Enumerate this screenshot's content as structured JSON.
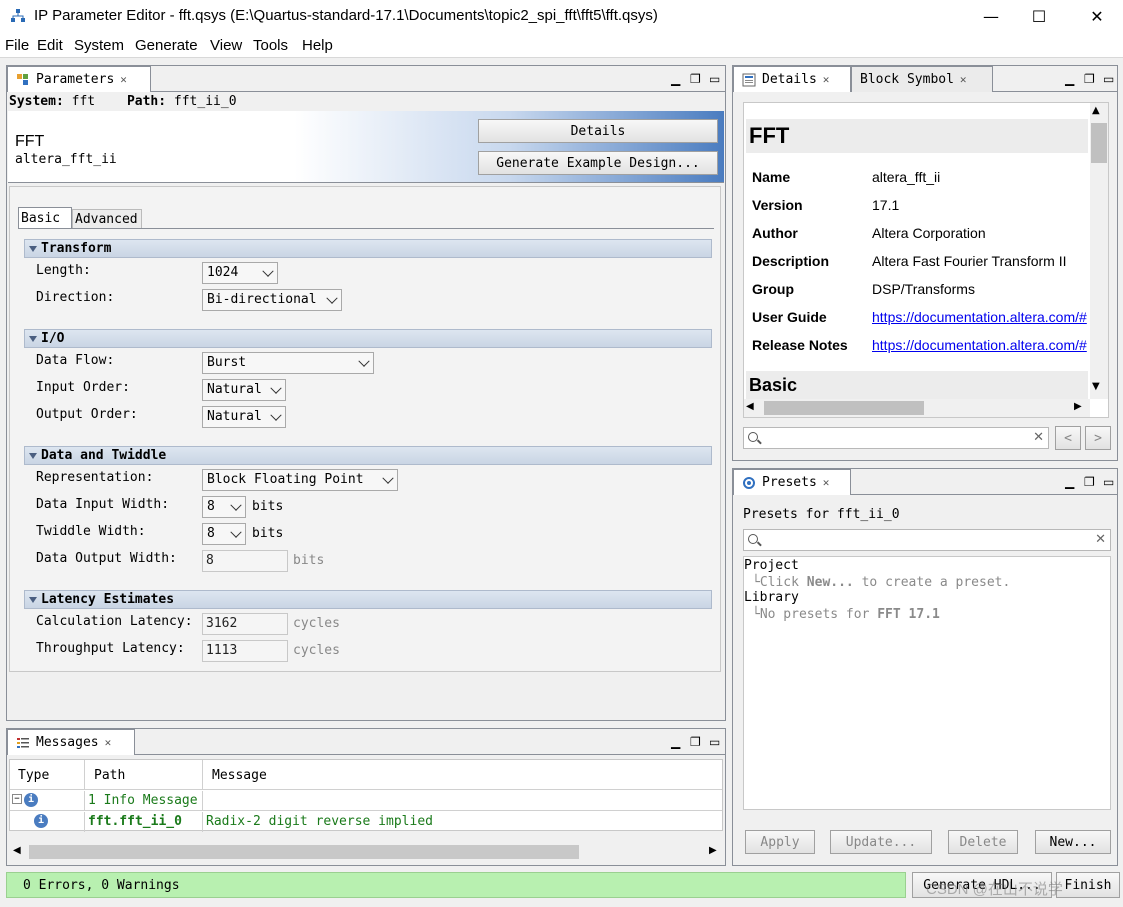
{
  "window": {
    "title": "IP Parameter Editor - fft.qsys (E:\\Quartus-standard-17.1\\Documents\\topic2_spi_fft\\fft5\\fft.qsys)",
    "minimize": "—",
    "maximize": "☐",
    "close": "✕"
  },
  "menu": [
    "File",
    "Edit",
    "System",
    "Generate",
    "View",
    "Tools",
    "Help"
  ],
  "parameters": {
    "tab": "Parameters",
    "system_label": "System:",
    "system_value": "fft",
    "path_label": "Path:",
    "path_value": "fft_ii_0",
    "component_name": "FFT",
    "component_id": "altera_fft_ii",
    "details_button": "Details",
    "example_button": "Generate Example Design...",
    "subtabs": [
      "Basic",
      "Advanced"
    ],
    "sections": {
      "transform": {
        "title": "Transform",
        "length_label": "Length:",
        "length_value": "1024",
        "direction_label": "Direction:",
        "direction_value": "Bi-directional"
      },
      "io": {
        "title": "I/O",
        "dataflow_label": "Data Flow:",
        "dataflow_value": "Burst",
        "input_order_label": "Input Order:",
        "input_order_value": "Natural",
        "output_order_label": "Output Order:",
        "output_order_value": "Natural"
      },
      "twiddle": {
        "title": "Data and Twiddle",
        "representation_label": "Representation:",
        "representation_value": "Block Floating Point",
        "data_in_label": "Data Input Width:",
        "data_in_value": "8",
        "twiddle_label": "Twiddle Width:",
        "twiddle_value": "8",
        "data_out_label": "Data Output Width:",
        "data_out_value": "8",
        "unit": "bits"
      },
      "latency": {
        "title": "Latency Estimates",
        "calc_label": "Calculation Latency:",
        "calc_value": "3162",
        "thru_label": "Throughput Latency:",
        "thru_value": "1113",
        "unit": "cycles"
      }
    }
  },
  "details": {
    "tab": "Details",
    "tab2": "Block Symbol",
    "heading": "FFT",
    "rows": [
      {
        "label": "Name",
        "value": "altera_fft_ii"
      },
      {
        "label": "Version",
        "value": "17.1"
      },
      {
        "label": "Author",
        "value": "Altera Corporation"
      },
      {
        "label": "Description",
        "value": "Altera Fast Fourier Transform II"
      },
      {
        "label": "Group",
        "value": "DSP/Transforms"
      },
      {
        "label": "User Guide",
        "value": "https://documentation.altera.com/#"
      },
      {
        "label": "Release Notes",
        "value": "https://documentation.altera.com/#"
      }
    ],
    "basic_heading": "Basic"
  },
  "presets": {
    "tab": "Presets",
    "for_label": "Presets for fft_ii_0",
    "project": "Project",
    "project_hint_pre": "Click ",
    "project_hint_bold": "New...",
    "project_hint_post": " to create a preset.",
    "library": "Library",
    "library_hint_pre": "No presets for ",
    "library_hint_bold": "FFT 17.1",
    "buttons": {
      "apply": "Apply",
      "update": "Update...",
      "delete": "Delete",
      "new": "New..."
    }
  },
  "messages": {
    "tab": "Messages",
    "columns": [
      "Type",
      "Path",
      "Message"
    ],
    "rows": [
      {
        "path": "1 Info Message",
        "message": ""
      },
      {
        "path": "fft.fft_ii_0",
        "message": "Radix-2 digit reverse implied"
      }
    ]
  },
  "status": {
    "text": "0 Errors, 0 Warnings",
    "generate": "Generate HDL...",
    "finish": "Finish",
    "watermark": "CSDN @在山不说学"
  },
  "colors": {
    "accent": "#4a7cc0",
    "status_green": "#b8f0b0",
    "link": "#0000ee"
  }
}
